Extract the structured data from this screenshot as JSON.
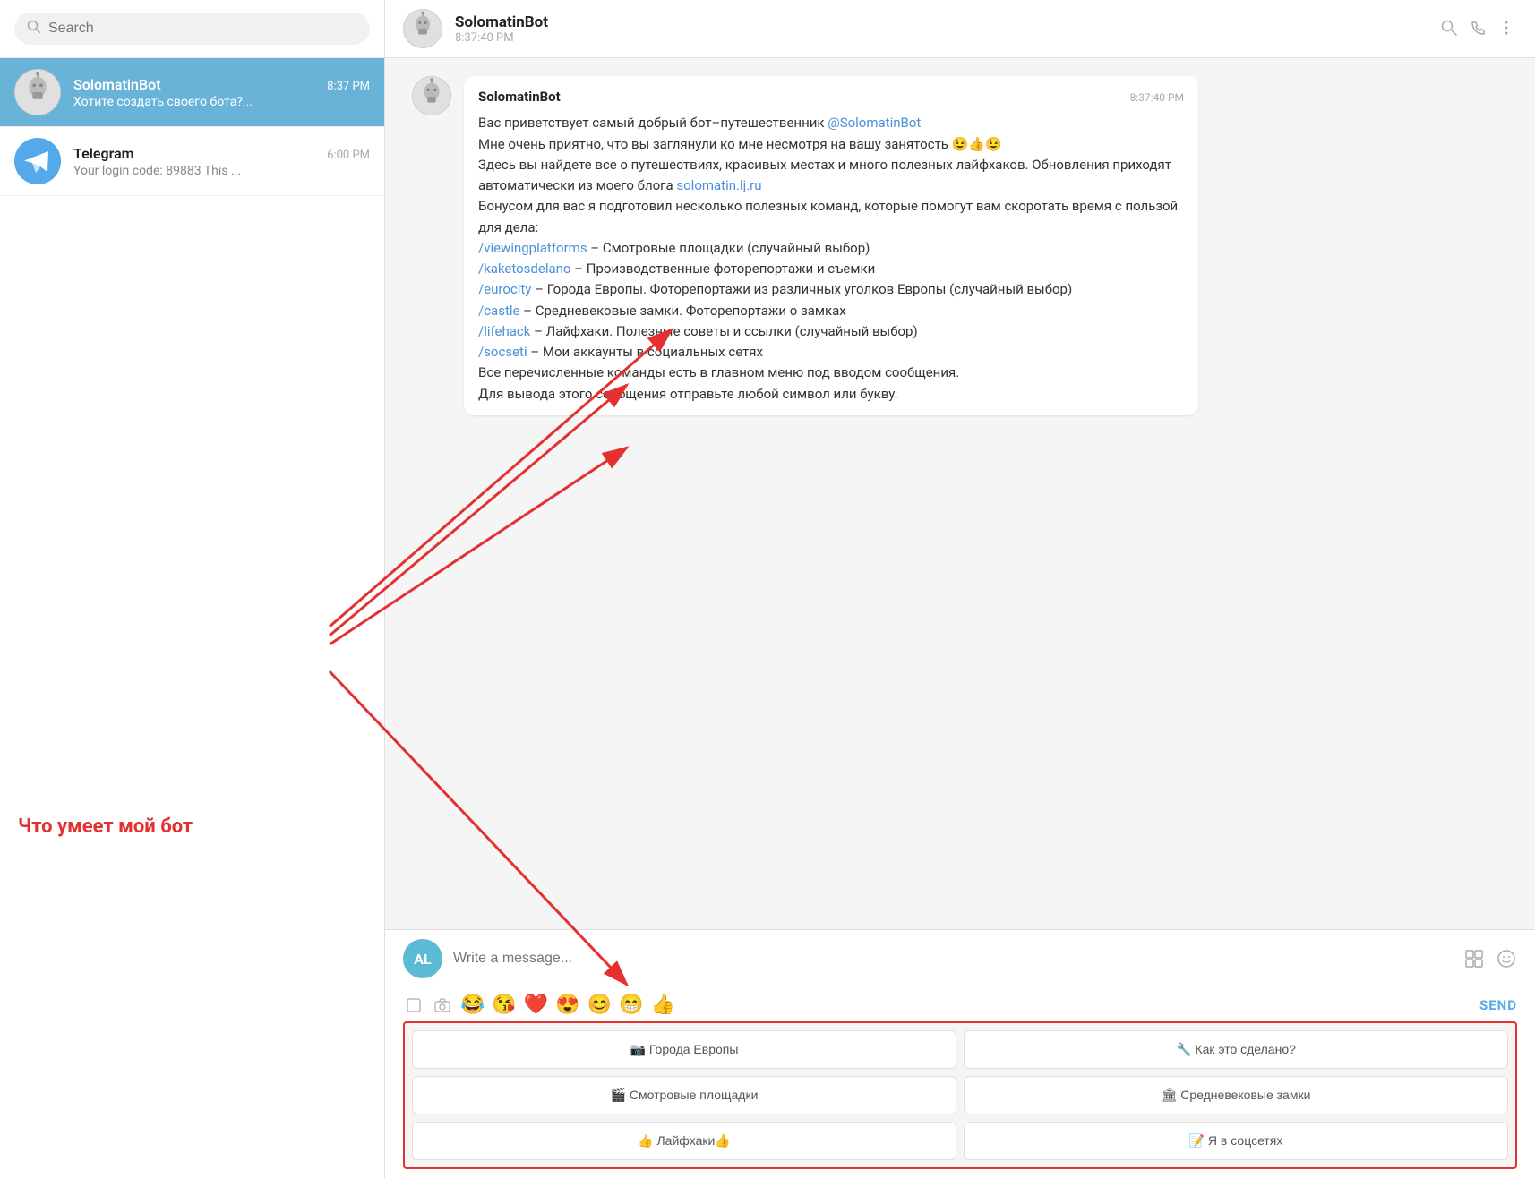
{
  "sidebar": {
    "search_placeholder": "Search",
    "chats": [
      {
        "id": "solomatinbot",
        "name": "SolomatinBot",
        "preview": "Хотите создать своего бота?...",
        "time": "8:37 PM",
        "active": true,
        "avatar_type": "bot"
      },
      {
        "id": "telegram",
        "name": "Telegram",
        "preview": "Your login code: 89883 This ...",
        "time": "6:00 PM",
        "active": false,
        "avatar_type": "telegram"
      }
    ]
  },
  "chat": {
    "header": {
      "name": "SolomatinBot",
      "time": "8:37:40 PM"
    },
    "messages": [
      {
        "sender": "SolomatinBot",
        "time": "8:37:40 PM",
        "text_parts": [
          {
            "type": "text",
            "content": "Вас приветствует самый добрый бот–путешественник "
          },
          {
            "type": "link",
            "content": "@SolomatinBot"
          },
          {
            "type": "text",
            "content": "\nМне очень приятно, что вы заглянули ко мне несмотря на вашу занятость 😉👍😉\nЗдесь вы найдете все о путешествиях, красивых местах и много полезных лайфхаков. Обновления приходят автоматически из моего блога "
          },
          {
            "type": "link",
            "content": "solomatin.lj.ru"
          },
          {
            "type": "text",
            "content": "\nБонусом для вас я подготовил несколько полезных команд, которые помогут вам скоротать время с пользой для дела:\n"
          },
          {
            "type": "link",
            "content": "/viewingplatforms"
          },
          {
            "type": "text",
            "content": " – Смотровые площадки (случайный выбор)\n"
          },
          {
            "type": "link",
            "content": "/kaketosdelano"
          },
          {
            "type": "text",
            "content": " – Производственные фоторепортажи и съемки\n"
          },
          {
            "type": "link",
            "content": "/eurocity"
          },
          {
            "type": "text",
            "content": " – Города Европы. Фоторепортажи из различных уголков Европы (случайный выбор)\n"
          },
          {
            "type": "link",
            "content": "/castle"
          },
          {
            "type": "text",
            "content": " – Средневековые замки. Фоторепортажи о замках\n"
          },
          {
            "type": "link",
            "content": "/lifehack"
          },
          {
            "type": "text",
            "content": " – Лайфхаки. Полезные советы и ссылки (случайный выбор)\n"
          },
          {
            "type": "link",
            "content": "/socseti"
          },
          {
            "type": "text",
            "content": " – Мои аккаунты в социальных сетях\nВсе перечисленные команды есть в главном меню под вводом сообщения.\nДля вывода этого сообщения отправьте любой символ или букву."
          }
        ]
      }
    ],
    "input": {
      "placeholder": "Write a message...",
      "user_initials": "AL",
      "send_label": "SEND"
    },
    "emojis": [
      "😂",
      "😘",
      "❤️",
      "😍",
      "😊",
      "😁",
      "👍"
    ],
    "keyboard": {
      "buttons": [
        [
          {
            "icon": "📷",
            "label": "Города Европы"
          },
          {
            "icon": "🔧",
            "label": "Как это сделано?"
          }
        ],
        [
          {
            "icon": "🎬",
            "label": "Смотровые площадки"
          },
          {
            "icon": "🏛",
            "label": "Средневековые замки"
          }
        ],
        [
          {
            "icon": "👍",
            "label": "Лайфхаки👍"
          },
          {
            "icon": "📝",
            "label": "Я в соцсетях"
          }
        ]
      ]
    }
  },
  "annotation": {
    "text": "Что умеет мой бот"
  }
}
